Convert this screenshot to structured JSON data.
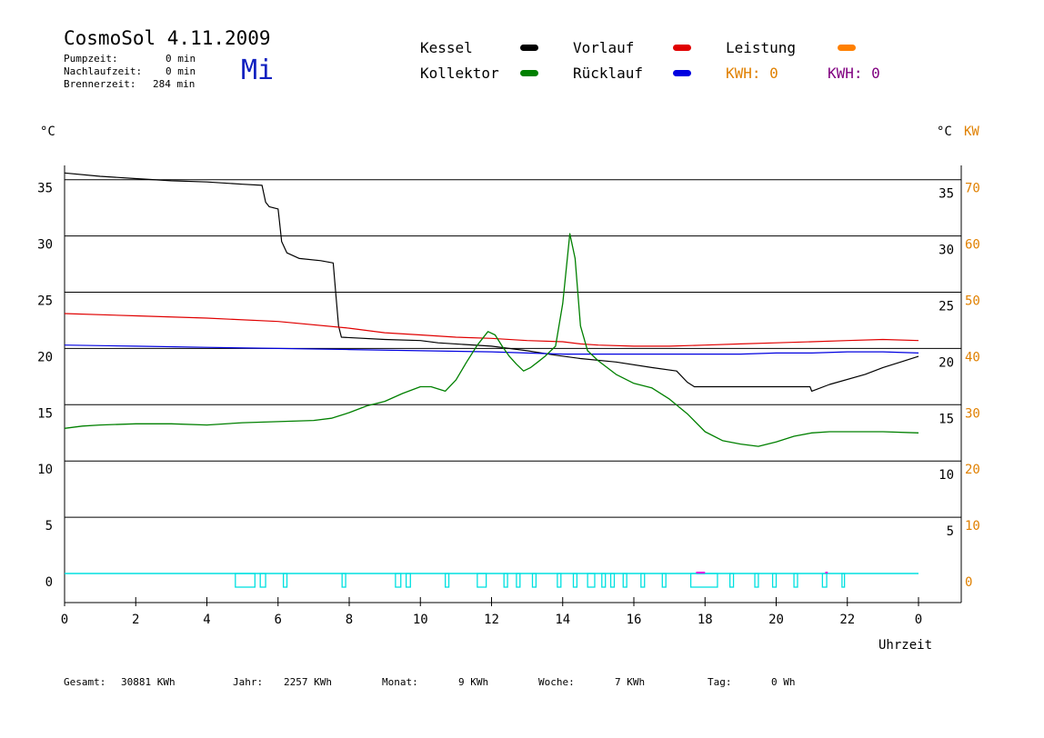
{
  "header": {
    "title": "CosmoSol 4.11.2009",
    "day": "Mi",
    "pump_label": "Pumpzeit:",
    "pump_value": "0 min",
    "nachlauf_label": "Nachlaufzeit:",
    "nachlauf_value": "0 min",
    "brenner_label": "Brennerzeit:",
    "brenner_value": "284 min"
  },
  "legend": {
    "kessel": "Kessel",
    "kollektor": "Kollektor",
    "vorlauf": "Vorlauf",
    "ruecklauf": "Rücklauf",
    "leistung": "Leistung",
    "kwh_orange": "KWH: 0",
    "kwh_purple": "KWH: 0"
  },
  "footer": {
    "gesamt_label": "Gesamt:",
    "gesamt_value": "30881 KWh",
    "jahr_label": "Jahr:",
    "jahr_value": "2257 KWh",
    "monat_label": "Monat:",
    "monat_value": "9 KWh",
    "woche_label": "Woche:",
    "woche_value": "7 KWh",
    "tag_label": "Tag:",
    "tag_value": "0 Wh"
  },
  "colors": {
    "kessel": "#000000",
    "kollektor": "#008000",
    "vorlauf": "#e00000",
    "ruecklauf": "#0000e0",
    "leistung": "#ff8000",
    "kw_axis": "#e08000",
    "kwh_purple": "#800080",
    "pump": "#00e0e0",
    "pump_magenta": "#e000e0",
    "day": "#1020c0"
  },
  "chart_data": {
    "type": "line",
    "xlabel": "Uhrzeit",
    "ylabel_left": "°C",
    "ylabel_right_celsius": "°C",
    "ylabel_right_kw": "KW",
    "xlim": [
      0,
      24
    ],
    "ylim": [
      0,
      35
    ],
    "x_ticks": [
      "0",
      "2",
      "4",
      "6",
      "8",
      "10",
      "12",
      "14",
      "16",
      "18",
      "20",
      "22",
      "0"
    ],
    "y_ticks_left": [
      "35",
      "30",
      "25",
      "20",
      "15",
      "10",
      "5",
      "0"
    ],
    "y_ticks_right": [
      "35",
      "30",
      "25",
      "20",
      "15",
      "10",
      "5"
    ],
    "kw_ticks": [
      "70",
      "60",
      "50",
      "40",
      "30",
      "20",
      "10",
      "0"
    ],
    "grid": true,
    "series": [
      {
        "name": "Kessel",
        "color_key": "kessel",
        "points": [
          [
            0,
            35.6
          ],
          [
            1,
            35.3
          ],
          [
            2,
            35.1
          ],
          [
            3,
            34.9
          ],
          [
            4,
            34.8
          ],
          [
            5,
            34.6
          ],
          [
            5.55,
            34.5
          ],
          [
            5.65,
            33
          ],
          [
            5.75,
            32.6
          ],
          [
            6.0,
            32.4
          ],
          [
            6.05,
            31
          ],
          [
            6.1,
            29.5
          ],
          [
            6.25,
            28.5
          ],
          [
            6.6,
            28
          ],
          [
            7.2,
            27.8
          ],
          [
            7.55,
            27.6
          ],
          [
            7.62,
            25
          ],
          [
            7.7,
            22
          ],
          [
            7.78,
            21
          ],
          [
            9,
            20.8
          ],
          [
            10,
            20.7
          ],
          [
            10.5,
            20.5
          ],
          [
            12,
            20.2
          ],
          [
            13,
            19.8
          ],
          [
            13.8,
            19.4
          ],
          [
            14.5,
            19.1
          ],
          [
            15.5,
            18.8
          ],
          [
            16.5,
            18.3
          ],
          [
            17.2,
            18.0
          ],
          [
            17.5,
            17
          ],
          [
            17.7,
            16.6
          ],
          [
            18.5,
            16.6
          ],
          [
            20,
            16.6
          ],
          [
            20.95,
            16.6
          ],
          [
            21.0,
            16.2
          ],
          [
            21.5,
            16.8
          ],
          [
            22.5,
            17.7
          ],
          [
            23.0,
            18.3
          ],
          [
            23.5,
            18.8
          ],
          [
            24,
            19.3
          ]
        ]
      },
      {
        "name": "Vorlauf",
        "color_key": "vorlauf",
        "points": [
          [
            0,
            23.1
          ],
          [
            2,
            22.9
          ],
          [
            4,
            22.7
          ],
          [
            6,
            22.4
          ],
          [
            8,
            21.8
          ],
          [
            9,
            21.4
          ],
          [
            10,
            21.2
          ],
          [
            11,
            21.0
          ],
          [
            12,
            20.9
          ],
          [
            13,
            20.7
          ],
          [
            14,
            20.6
          ],
          [
            14.5,
            20.4
          ],
          [
            15,
            20.3
          ],
          [
            16,
            20.2
          ],
          [
            17,
            20.2
          ],
          [
            18,
            20.3
          ],
          [
            19,
            20.4
          ],
          [
            20,
            20.5
          ],
          [
            21,
            20.6
          ],
          [
            22,
            20.7
          ],
          [
            23,
            20.8
          ],
          [
            24,
            20.7
          ]
        ]
      },
      {
        "name": "Rücklauf",
        "color_key": "ruecklauf",
        "points": [
          [
            0,
            20.3
          ],
          [
            2,
            20.2
          ],
          [
            4,
            20.1
          ],
          [
            6,
            20.0
          ],
          [
            8,
            19.9
          ],
          [
            10,
            19.8
          ],
          [
            12,
            19.7
          ],
          [
            13,
            19.6
          ],
          [
            14,
            19.5
          ],
          [
            15,
            19.5
          ],
          [
            16,
            19.5
          ],
          [
            17,
            19.5
          ],
          [
            18,
            19.5
          ],
          [
            19,
            19.5
          ],
          [
            20,
            19.6
          ],
          [
            21,
            19.6
          ],
          [
            22,
            19.7
          ],
          [
            23,
            19.7
          ],
          [
            24,
            19.6
          ]
        ]
      },
      {
        "name": "Kollektor",
        "color_key": "kollektor",
        "points": [
          [
            0,
            12.9
          ],
          [
            0.5,
            13.1
          ],
          [
            1,
            13.2
          ],
          [
            2,
            13.3
          ],
          [
            3,
            13.3
          ],
          [
            4,
            13.2
          ],
          [
            5,
            13.4
          ],
          [
            6,
            13.5
          ],
          [
            7,
            13.6
          ],
          [
            7.5,
            13.8
          ],
          [
            8,
            14.3
          ],
          [
            8.5,
            14.9
          ],
          [
            9,
            15.3
          ],
          [
            9.5,
            16.0
          ],
          [
            10,
            16.6
          ],
          [
            10.3,
            16.6
          ],
          [
            10.7,
            16.2
          ],
          [
            11,
            17.2
          ],
          [
            11.3,
            18.8
          ],
          [
            11.6,
            20.3
          ],
          [
            11.9,
            21.5
          ],
          [
            12.1,
            21.2
          ],
          [
            12.3,
            20.2
          ],
          [
            12.5,
            19.3
          ],
          [
            12.7,
            18.6
          ],
          [
            12.9,
            18.0
          ],
          [
            13.1,
            18.3
          ],
          [
            13.3,
            18.8
          ],
          [
            13.5,
            19.3
          ],
          [
            13.8,
            20.2
          ],
          [
            14.0,
            24
          ],
          [
            14.2,
            30.2
          ],
          [
            14.35,
            28
          ],
          [
            14.5,
            22
          ],
          [
            14.7,
            19.8
          ],
          [
            15,
            18.9
          ],
          [
            15.5,
            17.7
          ],
          [
            16,
            16.9
          ],
          [
            16.5,
            16.5
          ],
          [
            17,
            15.5
          ],
          [
            17.5,
            14.2
          ],
          [
            18,
            12.6
          ],
          [
            18.5,
            11.8
          ],
          [
            19,
            11.5
          ],
          [
            19.5,
            11.3
          ],
          [
            20,
            11.7
          ],
          [
            20.5,
            12.2
          ],
          [
            21,
            12.5
          ],
          [
            21.5,
            12.6
          ],
          [
            22,
            12.6
          ],
          [
            23,
            12.6
          ],
          [
            24,
            12.5
          ]
        ]
      }
    ],
    "pump_pulses_hours": [
      [
        4.8,
        5.35
      ],
      [
        5.5,
        5.65
      ],
      [
        6.15,
        6.25
      ],
      [
        7.8,
        7.9
      ],
      [
        9.3,
        9.45
      ],
      [
        9.6,
        9.72
      ],
      [
        10.7,
        10.8
      ],
      [
        11.6,
        11.85
      ],
      [
        12.35,
        12.45
      ],
      [
        12.7,
        12.8
      ],
      [
        13.15,
        13.25
      ],
      [
        13.85,
        13.95
      ],
      [
        14.3,
        14.4
      ],
      [
        14.7,
        14.9
      ],
      [
        15.1,
        15.2
      ],
      [
        15.35,
        15.45
      ],
      [
        15.7,
        15.8
      ],
      [
        16.2,
        16.3
      ],
      [
        16.8,
        16.9
      ],
      [
        17.6,
        18.35
      ],
      [
        18.7,
        18.8
      ],
      [
        19.4,
        19.5
      ],
      [
        19.9,
        20.0
      ],
      [
        20.5,
        20.6
      ],
      [
        21.3,
        21.42
      ],
      [
        21.85,
        21.92
      ]
    ],
    "pump_magenta_hours": [
      [
        17.75,
        18.0
      ],
      [
        21.38,
        21.45
      ]
    ]
  }
}
